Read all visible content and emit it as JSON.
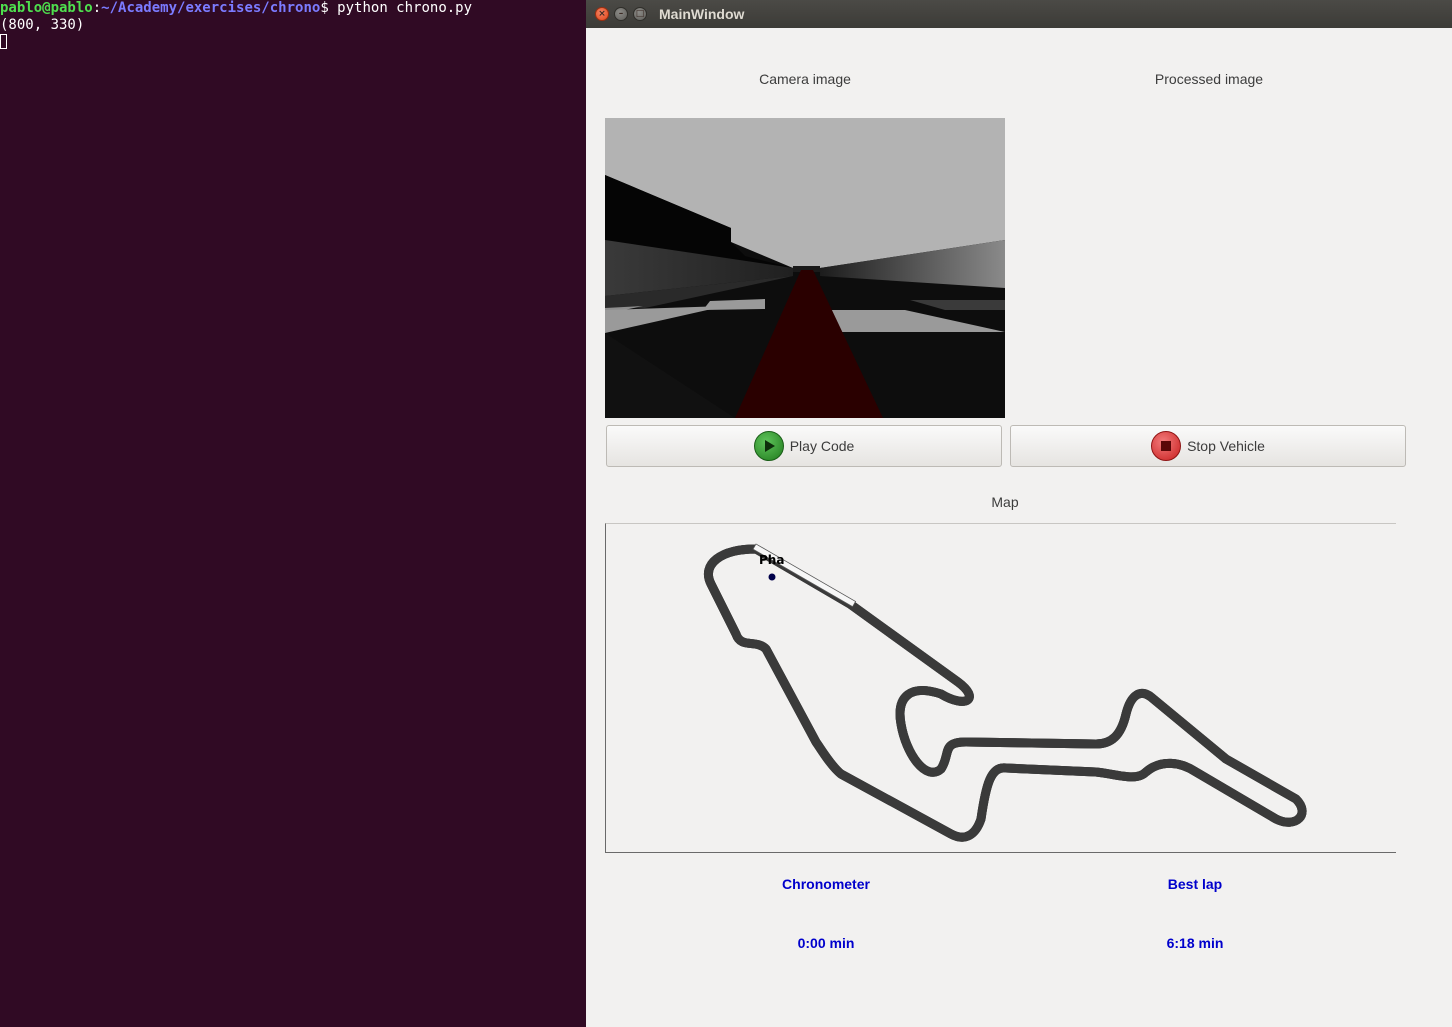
{
  "terminal": {
    "prompt_user": "pablo@pablo",
    "prompt_sep": ":",
    "prompt_path": "~/Academy/exercises/chrono",
    "prompt_end": "$ ",
    "command": "python chrono.py",
    "output": "(800, 330)"
  },
  "window": {
    "title": "MainWindow",
    "close_glyph": "×",
    "min_glyph": "–",
    "max_glyph": "□"
  },
  "panels": {
    "camera_label": "Camera image",
    "processed_label": "Processed image",
    "map_label": "Map"
  },
  "buttons": {
    "play_label": "Play Code",
    "stop_label": "Stop Vehicle"
  },
  "map": {
    "car_label": "Pha"
  },
  "stats": {
    "chrono_label": "Chronometer",
    "chrono_value": "0:00 min",
    "best_label": "Best lap",
    "best_value": "6:18 min"
  },
  "colors": {
    "terminal_bg": "#300a24",
    "stat_text": "#0000cc",
    "track_road": "#2a0000"
  }
}
